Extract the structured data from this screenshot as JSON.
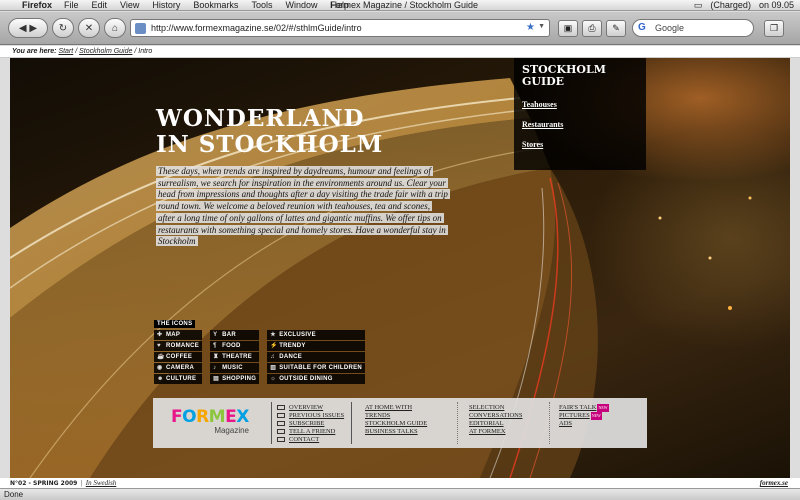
{
  "menubar": {
    "app": "Firefox",
    "items": [
      "File",
      "Edit",
      "View",
      "History",
      "Bookmarks",
      "Tools",
      "Window",
      "Help"
    ],
    "window_title": "Formex Magazine / Stockholm Guide",
    "battery": "(Charged)",
    "clock": "on 09.05"
  },
  "toolbar": {
    "url": "http://www.formexmagazine.se/02/#/sthlmGuide/intro",
    "search_placeholder": "Google"
  },
  "breadcrumb": {
    "label": "You are here:",
    "items": [
      "Start",
      "Stockholm Guide"
    ],
    "current": "Intro",
    "sep": "/"
  },
  "hero": {
    "title_line1": "WONDERLAND",
    "title_line2": "IN STOCKHOLM",
    "intro_text": "These days, when trends are inspired by daydreams, humour and feelings of surrealism, we search for inspiration in the environments around us. Clear your head from impressions and thoughts after a day visiting the trade fair with a trip round town. We welcome a beloved reunion with teahouses, tea and scones, after a long time of only gallons of lattes and gigantic muffins. We offer tips on restaurants with something special and homely stores. Have a wonderful stay in Stockholm"
  },
  "guide": {
    "heading_line1": "STOCKHOLM",
    "heading_line2": "GUIDE",
    "links": [
      "Teahouses",
      "Restaurants",
      "Stores"
    ]
  },
  "icons": {
    "heading": "THE ICONS",
    "col1": [
      {
        "glyph": "✚",
        "label": "MAP",
        "icon": "map-icon"
      },
      {
        "glyph": "♥",
        "label": "ROMANCE",
        "icon": "heart-icon"
      },
      {
        "glyph": "☕",
        "label": "COFFEE",
        "icon": "coffee-icon"
      },
      {
        "glyph": "◉",
        "label": "CAMERA",
        "icon": "camera-icon"
      },
      {
        "glyph": "☻",
        "label": "CULTURE",
        "icon": "culture-icon"
      }
    ],
    "col2": [
      {
        "glyph": "Y",
        "label": "BAR",
        "icon": "bar-icon"
      },
      {
        "glyph": "¶",
        "label": "FOOD",
        "icon": "food-icon"
      },
      {
        "glyph": "♜",
        "label": "THEATRE",
        "icon": "theatre-icon"
      },
      {
        "glyph": "♪",
        "label": "MUSIC",
        "icon": "music-icon"
      },
      {
        "glyph": "▤",
        "label": "SHOPPING",
        "icon": "shopping-icon"
      }
    ],
    "col3": [
      {
        "glyph": "★",
        "label": "EXCLUSIVE",
        "icon": "star-icon"
      },
      {
        "glyph": "⚡",
        "label": "TRENDY",
        "icon": "trendy-icon"
      },
      {
        "glyph": "♫",
        "label": "DANCE",
        "icon": "dance-icon"
      },
      {
        "glyph": "▥",
        "label": "SUITABLE FOR CHILDREN",
        "icon": "children-icon"
      },
      {
        "glyph": "☼",
        "label": "OUTSIDE DINING",
        "icon": "sun-icon"
      }
    ]
  },
  "footer": {
    "logo_text": "FORMEX",
    "logo_sub": "Magazine",
    "logo_colors": [
      "#e8168b",
      "#00a0e3",
      "#f7a600",
      "#8cc63f",
      "#e8168b",
      "#00a0e3"
    ],
    "col_icons": [
      "OVERVIEW",
      "PREVIOUS ISSUES",
      "SUBSCRIBE",
      "TELL A FRIEND",
      "CONTACT"
    ],
    "col_a": [
      "AT HOME WITH",
      "TRENDS",
      "STOCKHOLM GUIDE",
      "BUSINESS TALKS"
    ],
    "col_b": [
      "SELECTION",
      "CONVERSATIONS",
      "EDITORIAL",
      "AT FORMEX"
    ],
    "col_c": [
      "FAIR'S TALK",
      "PICTURES",
      "ADS"
    ],
    "new_badge": "NEW"
  },
  "pagebar": {
    "issue": "N°02 - SPRING 2009",
    "lang": "In Swedish",
    "site": "formex.se"
  },
  "status": "Done"
}
